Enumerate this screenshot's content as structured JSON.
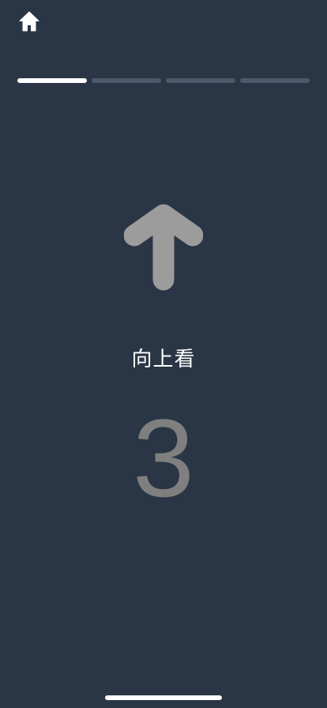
{
  "header": {
    "home_icon": "home-icon"
  },
  "progress": {
    "total_steps": 4,
    "current_step": 1,
    "active_color": "#ffffff",
    "inactive_color": "#4b5a6b"
  },
  "main": {
    "arrow_icon": "arrow-up-icon",
    "arrow_color": "#9c9c9c",
    "instruction": "向上看",
    "countdown": "3"
  },
  "colors": {
    "background": "#2a3645"
  }
}
